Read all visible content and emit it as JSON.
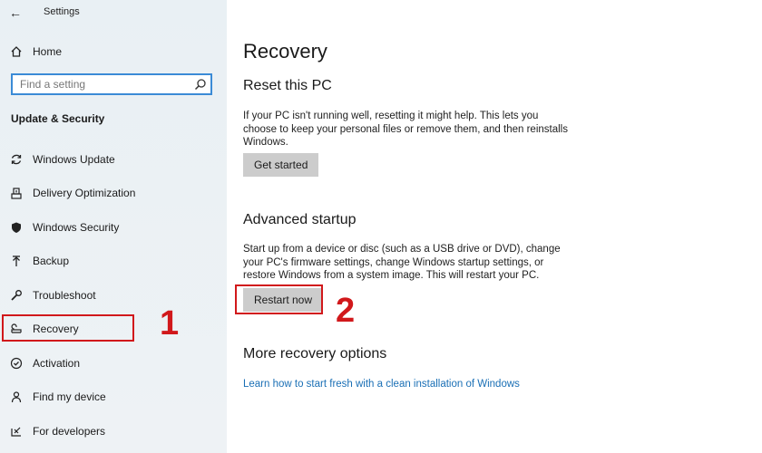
{
  "window": {
    "title": "Settings"
  },
  "sidebar": {
    "home_label": "Home",
    "search_placeholder": "Find a setting",
    "section_title": "Update & Security",
    "items": [
      {
        "label": "Windows Update",
        "icon": "sync-icon"
      },
      {
        "label": "Delivery Optimization",
        "icon": "delivery-optimization-icon"
      },
      {
        "label": "Windows Security",
        "icon": "shield-icon"
      },
      {
        "label": "Backup",
        "icon": "backup-arrow-icon"
      },
      {
        "label": "Troubleshoot",
        "icon": "wrench-icon"
      },
      {
        "label": "Recovery",
        "icon": "recovery-icon"
      },
      {
        "label": "Activation",
        "icon": "check-circle-icon"
      },
      {
        "label": "Find my device",
        "icon": "person-pin-icon"
      },
      {
        "label": "For developers",
        "icon": "developer-icon"
      }
    ]
  },
  "main": {
    "title": "Recovery",
    "reset": {
      "heading": "Reset this PC",
      "description": "If your PC isn't running well, resetting it might help. This lets you choose to keep your personal files or remove them, and then reinstalls Windows.",
      "button": "Get started"
    },
    "advanced": {
      "heading": "Advanced startup",
      "description": "Start up from a device or disc (such as a USB drive or DVD), change your PC's firmware settings, change Windows startup settings, or restore Windows from a system image. This will restart your PC.",
      "button": "Restart now"
    },
    "more": {
      "heading": "More recovery options",
      "link": "Learn how to start fresh with a clean installation of Windows"
    }
  },
  "annotations": {
    "step1": "1",
    "step2": "2"
  },
  "colors": {
    "highlight": "#d1181b",
    "link": "#1a6fb5",
    "search_border": "#3b8bd6"
  }
}
